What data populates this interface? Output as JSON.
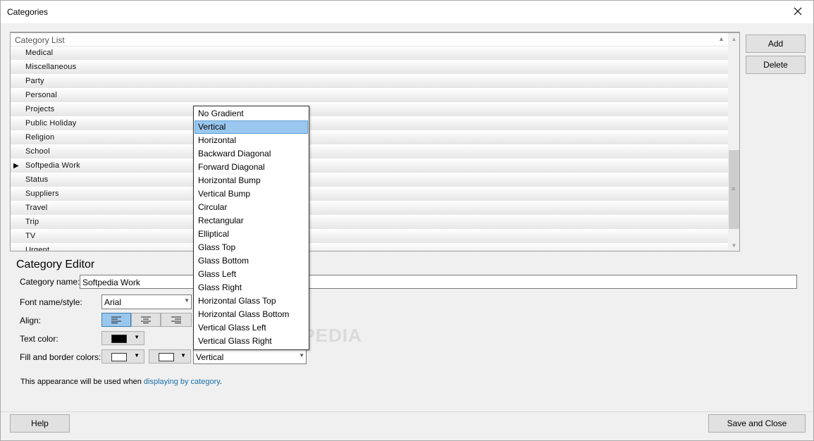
{
  "window": {
    "title": "Categories"
  },
  "grid": {
    "header": "Category List",
    "rows": [
      "Medical",
      "Miscellaneous",
      "Party",
      "Personal",
      "Projects",
      "Public Holiday",
      "Religion",
      "School",
      "Softpedia Work",
      "Status",
      "Suppliers",
      "Travel",
      "Trip",
      "TV",
      "Urgent"
    ],
    "current_row": "Softpedia Work"
  },
  "buttons": {
    "add": "Add",
    "delete": "Delete",
    "help": "Help",
    "save_close": "Save and Close"
  },
  "editor": {
    "title": "Category Editor",
    "name_label": "Category name:",
    "name_value": "Softpedia Work",
    "font_label": "Font name/style:",
    "font_value": "Arial",
    "align_label": "Align:",
    "align_selected": "left",
    "text_color_label": "Text color:",
    "text_color": "#000000",
    "fill_label": "Fill and border colors:",
    "fill_color": "#ffffff",
    "border_color": "#ffffff",
    "gradient_value": "Vertical"
  },
  "info": {
    "text": "This appearance will be used when ",
    "link": "displaying by category",
    "end": "."
  },
  "gradient_options": [
    "No Gradient",
    "Vertical",
    "Horizontal",
    "Backward Diagonal",
    "Forward Diagonal",
    "Horizontal Bump",
    "Vertical Bump",
    "Circular",
    "Rectangular",
    "Elliptical",
    "Glass Top",
    "Glass Bottom",
    "Glass Left",
    "Glass Right",
    "Horizontal Glass Top",
    "Horizontal Glass Bottom",
    "Vertical Glass Left",
    "Vertical Glass Right"
  ],
  "gradient_selected": "Vertical",
  "watermark": "SOFTPEDIA"
}
